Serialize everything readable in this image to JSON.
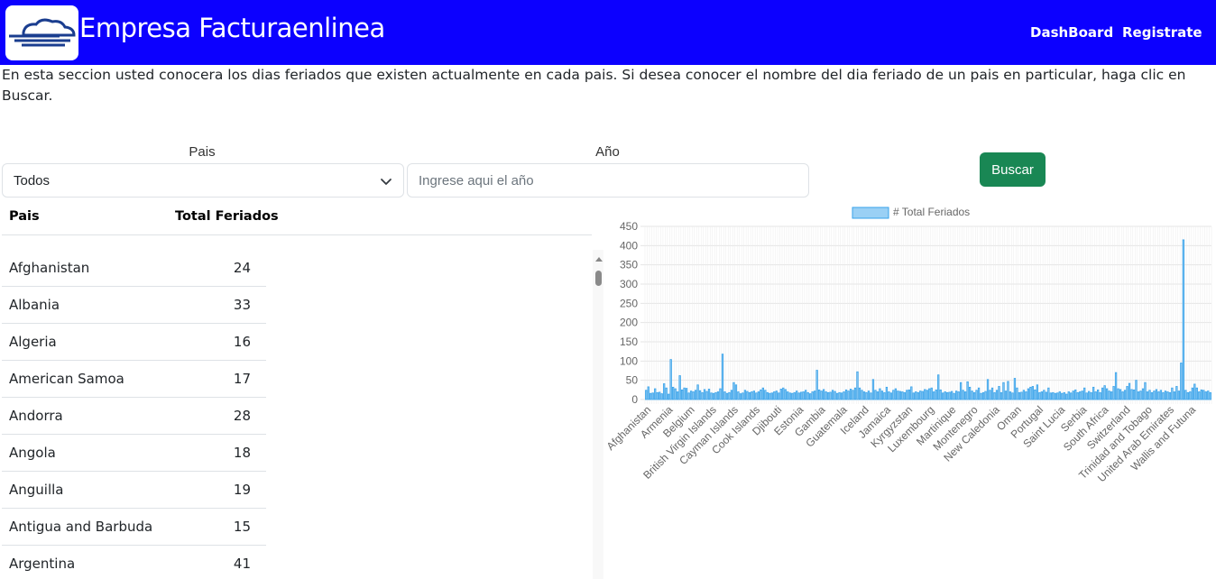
{
  "header": {
    "brand": "Empresa Facturaenlinea",
    "nav": {
      "dashboard": "DashBoard",
      "register": "Registrate"
    },
    "logo_icon": "cloud-wind-icon"
  },
  "intro": "En esta seccion usted conocera los dias feriados que existen actualmente en cada pais. Si desea conocer el nombre del dia feriado de un pais en particular, haga clic en Buscar.",
  "filters": {
    "pais_label": "Pais",
    "pais_selected": "Todos",
    "anio_label": "Año",
    "anio_placeholder": "Ingrese aqui el año",
    "search_button": "Buscar"
  },
  "table": {
    "columns": [
      "Pais",
      "Total Feriados"
    ],
    "rows": [
      {
        "pais": "Afghanistan",
        "total": "24"
      },
      {
        "pais": "Albania",
        "total": "33"
      },
      {
        "pais": "Algeria",
        "total": "16"
      },
      {
        "pais": "American Samoa",
        "total": "17"
      },
      {
        "pais": "Andorra",
        "total": "28"
      },
      {
        "pais": "Angola",
        "total": "18"
      },
      {
        "pais": "Anguilla",
        "total": "19"
      },
      {
        "pais": "Antigua and Barbuda",
        "total": "15"
      },
      {
        "pais": "Argentina",
        "total": "41"
      }
    ]
  },
  "colors": {
    "navbar": "#0c00ff",
    "button": "#198754",
    "bar_fill": "#9ad0f5",
    "bar_stroke": "#36a2eb"
  },
  "chart_data": {
    "type": "bar",
    "legend": "# Total Feriados",
    "legend_position": "top",
    "grid": true,
    "ylim": [
      0,
      450
    ],
    "yticks": [
      0,
      50,
      100,
      150,
      200,
      250,
      300,
      350,
      400,
      450
    ],
    "tick_labels": [
      "Afghanistan",
      "Armenia",
      "Belgium",
      "British Virgin Islands",
      "Cayman Islands",
      "Cook Islands",
      "Djibouti",
      "Estonia",
      "Gambia",
      "Guatemala",
      "Iceland",
      "Jamaica",
      "Kyrgyzstan",
      "Luxembourg",
      "Martinique",
      "Montenegro",
      "New Caledonia",
      "Oman",
      "Portugal",
      "Saint Lucia",
      "Serbia",
      "South Africa",
      "Switzerland",
      "Trinidad and Tobago",
      "United Arab Emirates",
      "Wallis and Futuna"
    ],
    "values": [
      24,
      33,
      16,
      17,
      28,
      18,
      19,
      15,
      41,
      30,
      14,
      104,
      32,
      28,
      20,
      62,
      25,
      30,
      29,
      17,
      22,
      20,
      24,
      38,
      23,
      18,
      26,
      21,
      27,
      17,
      16,
      18,
      20,
      28,
      118,
      20,
      16,
      18,
      24,
      44,
      38,
      20,
      15,
      17,
      24,
      21,
      18,
      20,
      22,
      17,
      20,
      25,
      30,
      24,
      18,
      16,
      17,
      20,
      22,
      17,
      27,
      30,
      26,
      20,
      17,
      16,
      18,
      22,
      17,
      19,
      20,
      24,
      18,
      15,
      20,
      22,
      76,
      25,
      22,
      26,
      20,
      18,
      19,
      24,
      21,
      16,
      18,
      17,
      20,
      25,
      22,
      27,
      24,
      30,
      72,
      30,
      24,
      20,
      18,
      22,
      17,
      52,
      24,
      20,
      28,
      22,
      18,
      32,
      20,
      17,
      24,
      28,
      22,
      21,
      20,
      18,
      24,
      25,
      33,
      17,
      20,
      18,
      22,
      21,
      26,
      24,
      28,
      30,
      20,
      25,
      64,
      25,
      17,
      20,
      18,
      19,
      21,
      16,
      22,
      20,
      44,
      24,
      20,
      46,
      32,
      22,
      18,
      24,
      30,
      16,
      18,
      21,
      52,
      24,
      30,
      18,
      24,
      34,
      18,
      44,
      22,
      47,
      20,
      17,
      55,
      30,
      18,
      19,
      24,
      20,
      28,
      32,
      34,
      25,
      38,
      18,
      20,
      24,
      19,
      30,
      17,
      18,
      16,
      17,
      20,
      16,
      18,
      14,
      20,
      17,
      22,
      25,
      18,
      20,
      22,
      30,
      17,
      21,
      18,
      32,
      20,
      25,
      18,
      30,
      36,
      28,
      22,
      20,
      34,
      70,
      28,
      26,
      20,
      24,
      34,
      42,
      26,
      25,
      50,
      20,
      22,
      28,
      44,
      20,
      24,
      18,
      22,
      26,
      20,
      24,
      18,
      22,
      20,
      18,
      30,
      20,
      34,
      22,
      95,
      415,
      24,
      18,
      20,
      30,
      40,
      30,
      20,
      25,
      24,
      20,
      22,
      18
    ]
  }
}
